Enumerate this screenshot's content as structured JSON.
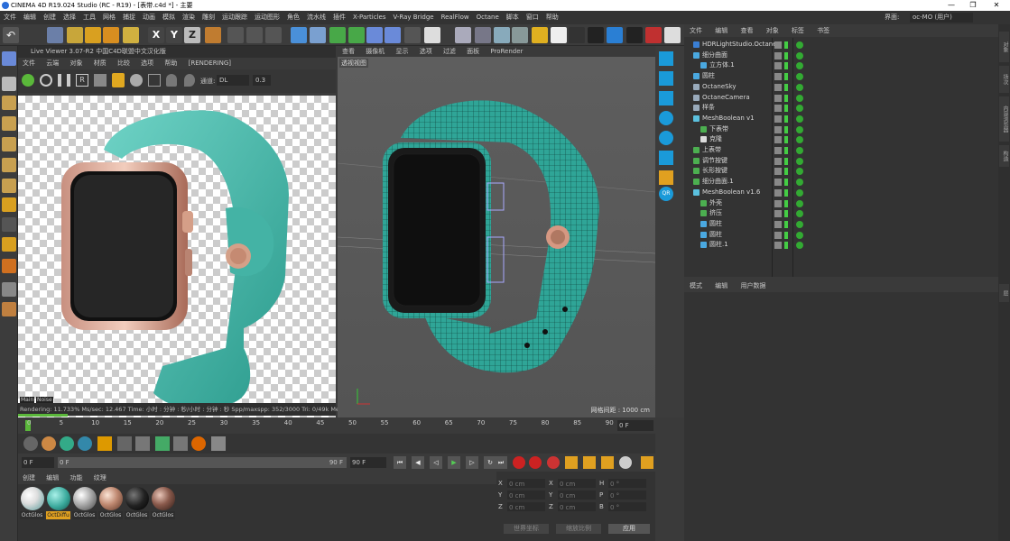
{
  "title": "CINEMA 4D R19.024 Studio (RC - R19) - [表带.c4d *] - 主要",
  "interface_label": "界面:",
  "interface_value": "oc-MO (用户)",
  "menu": [
    "文件",
    "编辑",
    "创建",
    "选择",
    "工具",
    "网格",
    "捕捉",
    "动画",
    "模拟",
    "渲染",
    "雕刻",
    "运动跟踪",
    "运动图形",
    "角色",
    "流水线",
    "插件",
    "X-Particles",
    "V-Ray Bridge",
    "RealFlow",
    "Octane",
    "脚本",
    "窗口",
    "帮助"
  ],
  "toolbar_letters": [
    "X",
    "Y",
    "Z"
  ],
  "live_viewer": {
    "title": "Live Viewer 3.07-R2 中国C4D联盟中文汉化版",
    "menu": [
      "文件",
      "云端",
      "对象",
      "材质",
      "比较",
      "选项",
      "帮助"
    ],
    "status_tag": "[RENDERING]",
    "channel_label": "通道:",
    "channel_value": "DL",
    "channel_num": "0.3",
    "tabs": [
      "Main",
      "Noise"
    ],
    "status": "Rendering: 11.733%   Ms/sec: 12.467   Time: 小时 : 分钟 : 秒/小时 : 分钟 : 秒   Spp/maxspp: 352/3000   Tri: 0/49k   Mesh: 7   Hr"
  },
  "viewport": {
    "menu": [
      "查看",
      "摄像机",
      "显示",
      "选项",
      "过滤",
      "面板",
      "ProRender"
    ],
    "label": "透视视图",
    "footer": "网格间距 : 1000 cm"
  },
  "object_manager": {
    "menu": [
      "文件",
      "编辑",
      "查看",
      "对象",
      "标签",
      "书签"
    ],
    "rows": [
      {
        "name": "HDRLightStudio.Octane",
        "indent": 0,
        "icon": "#3a7fd4"
      },
      {
        "name": "细分曲面",
        "indent": 0,
        "icon": "#4aa8e0"
      },
      {
        "name": "立方体.1",
        "indent": 1,
        "icon": "#4aa8e0"
      },
      {
        "name": "圆柱",
        "indent": 0,
        "icon": "#4aa8e0"
      },
      {
        "name": "OctaneSky",
        "indent": 0,
        "icon": "#9ab"
      },
      {
        "name": "OctaneCamera",
        "indent": 0,
        "icon": "#9ab"
      },
      {
        "name": "样条",
        "indent": 0,
        "icon": "#9ab"
      },
      {
        "name": "MeshBoolean v1",
        "indent": 0,
        "icon": "#5bc0de"
      },
      {
        "name": "下表带",
        "indent": 1,
        "icon": "#4caf50"
      },
      {
        "name": "克隆",
        "indent": 1,
        "icon": "#ddd"
      },
      {
        "name": "上表带",
        "indent": 0,
        "icon": "#4caf50"
      },
      {
        "name": "调节按键",
        "indent": 0,
        "icon": "#4caf50"
      },
      {
        "name": "长形按键",
        "indent": 0,
        "icon": "#4caf50"
      },
      {
        "name": "细分曲面.1",
        "indent": 0,
        "icon": "#4caf50"
      },
      {
        "name": "MeshBoolean v1.6",
        "indent": 0,
        "icon": "#5bc0de"
      },
      {
        "name": "外壳",
        "indent": 1,
        "icon": "#4caf50"
      },
      {
        "name": "挤压",
        "indent": 1,
        "icon": "#4caf50"
      },
      {
        "name": "圆柱",
        "indent": 1,
        "icon": "#4aa8e0"
      },
      {
        "name": "圆柱",
        "indent": 1,
        "icon": "#4aa8e0"
      },
      {
        "name": "圆柱.1",
        "indent": 1,
        "icon": "#4aa8e0"
      }
    ]
  },
  "attributes": {
    "menu": [
      "模式",
      "编辑",
      "用户数据"
    ]
  },
  "timeline": {
    "ticks": [
      "0",
      "5",
      "10",
      "15",
      "20",
      "25",
      "30",
      "35",
      "40",
      "45",
      "50",
      "55",
      "60",
      "65",
      "70",
      "75",
      "80",
      "85",
      "90"
    ],
    "end_frame": "0 F",
    "start_field": "0 F",
    "range_field": "0 F",
    "range_end": "90 F",
    "max_field": "90 F"
  },
  "materials": {
    "menu": [
      "创建",
      "编辑",
      "功能",
      "纹理"
    ],
    "items": [
      {
        "label": "OctGlos",
        "color": "radial-gradient(circle at 35% 35%,#fff,#ddd 40%,#9bb 70%)"
      },
      {
        "label": "OctDiffu",
        "color": "radial-gradient(circle at 35% 35%,#a8f0e8,#3aa99c 55%,#14524c)"
      },
      {
        "label": "OctGlos",
        "color": "radial-gradient(circle at 35% 35%,#fff,#aaa 45%,#444)"
      },
      {
        "label": "OctGlos",
        "color": "radial-gradient(circle at 35% 35%,#fbe4d6,#c08a72 45%,#5a3324)"
      },
      {
        "label": "OctGlos",
        "color": "radial-gradient(circle at 35% 35%,#777,#222 50%,#000)"
      },
      {
        "label": "OctGlos",
        "color": "radial-gradient(circle at 35% 35%,#e8c5b8,#8a5a4c 45%,#2c1a15)"
      }
    ]
  },
  "coordinates": {
    "rows": [
      {
        "a": "X",
        "av": "0 cm",
        "b": "X",
        "bv": "0 cm",
        "c": "H",
        "cv": "0 °"
      },
      {
        "a": "Y",
        "av": "0 cm",
        "b": "Y",
        "bv": "0 cm",
        "c": "P",
        "cv": "0 °"
      },
      {
        "a": "Z",
        "av": "0 cm",
        "b": "Z",
        "bv": "0 cm",
        "c": "B",
        "cv": "0 °"
      }
    ],
    "mode1": "世界坐标",
    "mode2": "缩放比例",
    "apply": "应用"
  },
  "side_tabs": [
    "对象",
    "场次",
    "内容浏览器",
    "构造",
    "层"
  ]
}
